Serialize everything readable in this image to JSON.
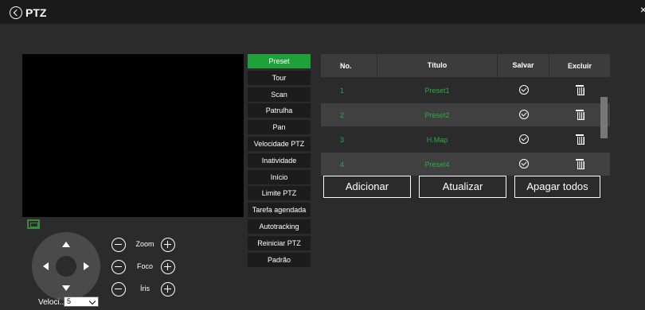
{
  "window": {
    "title": "PTZ",
    "close_symbol": "×"
  },
  "icons": {
    "back": "back-circle-icon",
    "close": "close-icon",
    "screen": "screen-icon"
  },
  "colors": {
    "accent": "#1fa03a",
    "preset_text": "#2aad43"
  },
  "controls": {
    "zoom_label": "Zoom",
    "focus_label": "Foco",
    "iris_label": "Íris",
    "speed_label": "Veloci...",
    "speed_value": "5"
  },
  "menu": {
    "items": [
      "Preset",
      "Tour",
      "Scan",
      "Patrulha",
      "Pan",
      "Velocidade PTZ",
      "Inatividade",
      "Início",
      "Limite PTZ",
      "Tarefa agendada",
      "Autotracking",
      "Reiniciar PTZ",
      "Padrão"
    ],
    "active": "Preset"
  },
  "table": {
    "headers": {
      "no": "No.",
      "title": "Título",
      "save": "Salvar",
      "delete": "Excluir"
    },
    "rows": [
      {
        "no": "1",
        "title": "Preset1"
      },
      {
        "no": "2",
        "title": "Preset2"
      },
      {
        "no": "3",
        "title": "H.Map"
      },
      {
        "no": "4",
        "title": "Preset4"
      }
    ]
  },
  "buttons": {
    "add": "Adicionar",
    "refresh": "Atualizar",
    "delete_all": "Apagar todos"
  }
}
